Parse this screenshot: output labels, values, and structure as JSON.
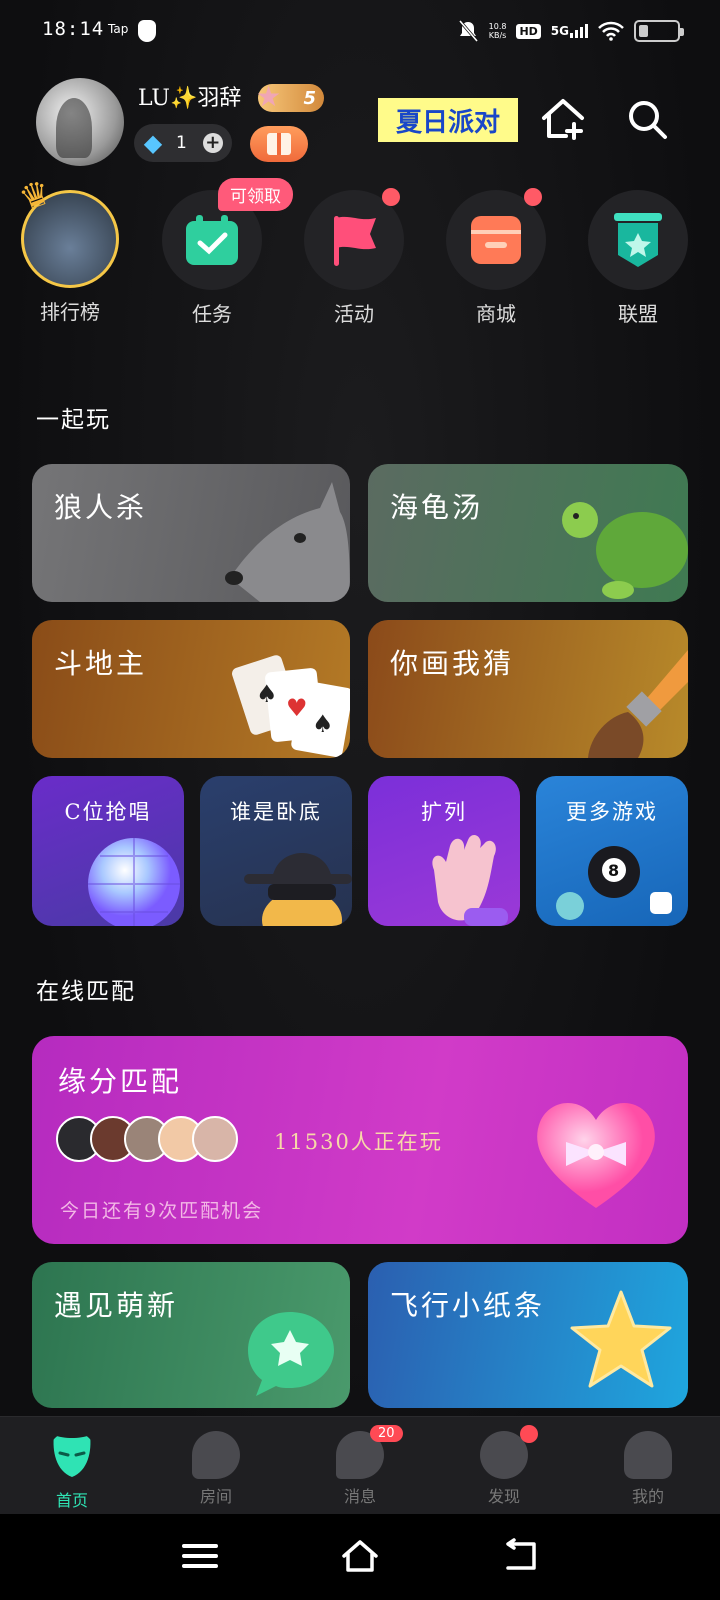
{
  "status": {
    "time": "18:14",
    "app_label": "Tap",
    "net_speed_value": "10.8",
    "net_speed_unit": "KB/s",
    "hd": "HD",
    "network": "5G",
    "battery_level": 0.25
  },
  "profile": {
    "username": "LU✨羽辞",
    "level": "5",
    "diamond_count": "1"
  },
  "header": {
    "party_banner": "夏日派对"
  },
  "quick_actions": [
    {
      "label": "排行榜",
      "icon": "ranking-avatar"
    },
    {
      "label": "任务",
      "icon": "task-calendar-icon",
      "badge": "可领取"
    },
    {
      "label": "活动",
      "icon": "flag-icon",
      "dot": true
    },
    {
      "label": "商城",
      "icon": "store-icon",
      "dot": true
    },
    {
      "label": "联盟",
      "icon": "alliance-shield-icon"
    }
  ],
  "play_together": {
    "title": "一起玩",
    "big_cards": [
      {
        "label": "狼人杀",
        "icon": "wolf-icon",
        "color": "#6b6b6d"
      },
      {
        "label": "海龟汤",
        "icon": "turtle-icon",
        "color": "#4e7c5e"
      },
      {
        "label": "斗地主",
        "icon": "playing-cards-icon",
        "color": "#9a5b1c"
      },
      {
        "label": "你画我猜",
        "icon": "paintbrush-icon",
        "color": "#a0651e"
      }
    ],
    "small_cards": [
      {
        "label": "C位抢唱",
        "icon": "disco-ball-icon"
      },
      {
        "label": "谁是卧底",
        "icon": "spy-hat-icon"
      },
      {
        "label": "扩列",
        "icon": "waving-hand-icon"
      },
      {
        "label": "更多游戏",
        "icon": "billiard-ball-icon"
      }
    ]
  },
  "online_match": {
    "title": "在线匹配",
    "card_title": "缘分匹配",
    "players_playing": "11530人正在玩",
    "remaining_chances": "今日还有9次匹配机会"
  },
  "bottom_cards": [
    {
      "label": "遇见萌新",
      "icon": "star-chat-bubble-icon"
    },
    {
      "label": "飞行小纸条",
      "icon": "star-icon"
    }
  ],
  "tabs": [
    {
      "label": "首页",
      "icon": "mask-icon",
      "active": true
    },
    {
      "label": "房间",
      "icon": "room-icon"
    },
    {
      "label": "消息",
      "icon": "message-icon",
      "badge": "20"
    },
    {
      "label": "发现",
      "icon": "planet-icon",
      "dot": true
    },
    {
      "label": "我的",
      "icon": "profile-icon"
    }
  ]
}
